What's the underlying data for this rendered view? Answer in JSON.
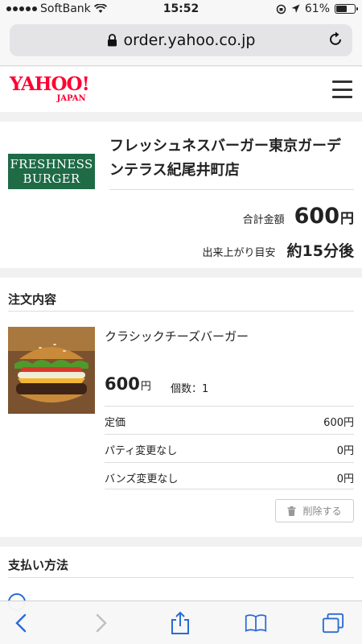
{
  "status_bar": {
    "carrier": "SoftBank",
    "time": "15:52",
    "battery": "61%",
    "battery_level": 0.61
  },
  "browser": {
    "url": "order.yahoo.co.jp"
  },
  "header": {
    "logo_main": "YAHOO!",
    "logo_sub": "JAPAN"
  },
  "store": {
    "logo_line1": "FRESHNESS",
    "logo_line2": "BURGER",
    "name": "フレッシュネスバーガー東京ガーデンテラス紀尾井町店",
    "total_label": "合計金額",
    "total_value": "600",
    "total_unit": "円",
    "eta_label": "出来上がり目安",
    "eta_value": "約15分後"
  },
  "order": {
    "section_title": "注文内容",
    "item": {
      "name": "クラシックチーズバーガー",
      "price": "600",
      "price_unit": "円",
      "quantity": "個数：1"
    },
    "details": [
      {
        "label": "定価",
        "value": "600円"
      },
      {
        "label": "パティ変更なし",
        "value": "0円"
      },
      {
        "label": "バンズ変更なし",
        "value": "0円"
      }
    ],
    "delete_label": "削除する"
  },
  "payment": {
    "section_title": "支払い方法"
  },
  "colors": {
    "yahoo_red": "#ff0033",
    "brand_green": "#1e6b46",
    "ios_blue": "#2a6bd6"
  }
}
